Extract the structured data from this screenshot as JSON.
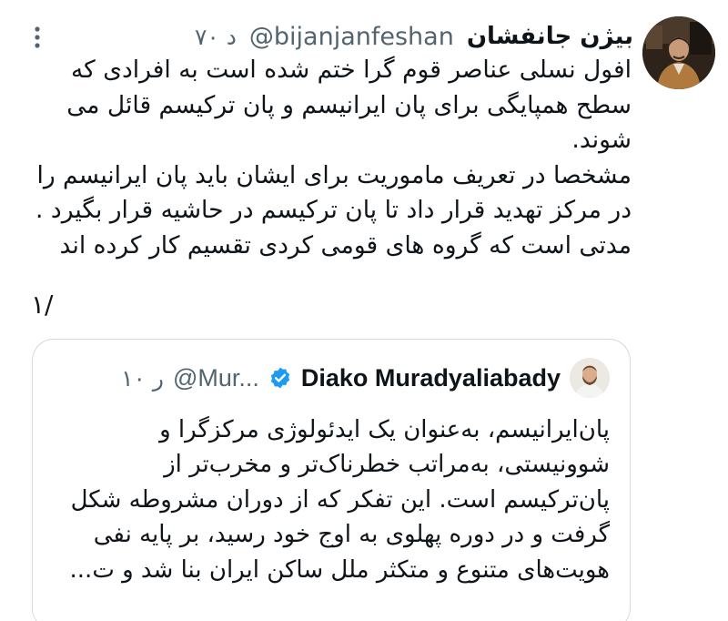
{
  "tweet": {
    "author_name": "بیژن جانفشان",
    "handle": "@bijanjanfeshan",
    "time": "۷۰ د",
    "more_icon": "more-dots-vertical-icon",
    "body_lines": [
      "افول نسلی عناصر قوم گرا ختم شده است به افرادی که",
      "سطح همپایگی برای پان ایرانیسم و پان ترکیسم قائل می",
      "شوند.",
      "مشخصا در تعریف ماموریت برای ایشان باید پان ایرانیسم را",
      "در مرکز تهدید قرار داد تا پان ترکیسم در حاشیه قرار بگیرد .",
      "مدتی است که گروه های قومی کردی تقسیم کار کرده اند"
    ],
    "thread_marker": "۱/"
  },
  "quote": {
    "author_name": "Diako Muradyaliabady",
    "handle": "@Mur...",
    "time": "۱۰ ر",
    "verified_icon": "verified-badge-icon",
    "body_lines": [
      "پان‌ایرانیسم، به‌عنوان یک ایدئولوژی مرکزگرا و",
      "شوونیستی، به‌مراتب خطرناک‌تر و مخرب‌تر از",
      "پان‌ترکیسم است. این تفکر که از دوران مشروطه شکل",
      "گرفت و در دوره پهلوی به اوج خود رسید، بر پایه نفی",
      "هویت‌های متنوع و متکثر ملل ساکن ایران بنا شد و ت..."
    ]
  },
  "colors": {
    "text": "#0f1419",
    "secondary": "#536471",
    "border": "#cfd9de",
    "verified": "#1d9bf0",
    "background": "#ffffff"
  }
}
